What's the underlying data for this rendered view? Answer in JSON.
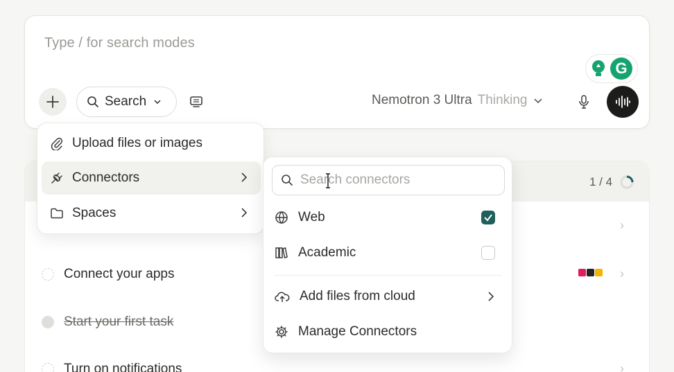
{
  "composer": {
    "placeholder": "Type / for search modes",
    "search_label": "Search",
    "model_name": "Nemotron 3 Ultra",
    "model_suffix": "Thinking"
  },
  "add_menu": {
    "items": [
      {
        "label": "Upload files or images",
        "icon": "paperclip-icon"
      },
      {
        "label": "Connectors",
        "icon": "plug-icon"
      },
      {
        "label": "Spaces",
        "icon": "folder-icon"
      }
    ]
  },
  "connectors_menu": {
    "search_placeholder": "Search connectors",
    "items": [
      {
        "label": "Web",
        "icon": "globe-icon",
        "checked": true
      },
      {
        "label": "Academic",
        "icon": "books-icon",
        "checked": false
      },
      {
        "label": "Add files from cloud",
        "icon": "cloud-upload-icon"
      },
      {
        "label": "Manage Connectors",
        "icon": "gear-icon"
      }
    ]
  },
  "checklist": {
    "progress": "1 / 4",
    "tasks": [
      {
        "label": "Connect your apps",
        "done": false
      },
      {
        "label": "Start your first task",
        "done": true
      },
      {
        "label": "Turn on notifications",
        "done": false
      }
    ]
  },
  "colors": {
    "accent": "#1f5f5c",
    "grammarly": "#15a36f",
    "voice_button": "#1c1c1a"
  }
}
